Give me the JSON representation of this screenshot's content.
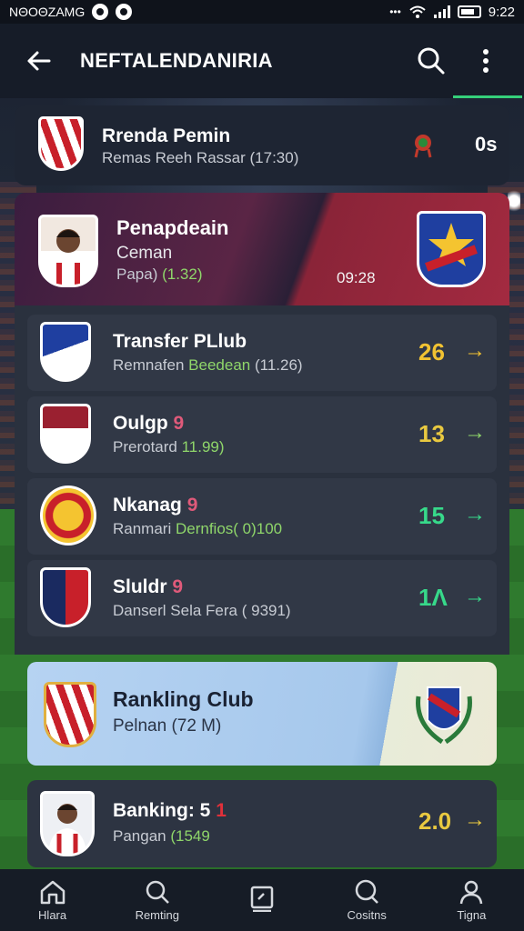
{
  "status_bar": {
    "left_text": "ΝΘΟΘΖΑΜG",
    "time": "9:22"
  },
  "app_bar": {
    "title": "NEFTALENDANIRIA"
  },
  "header_card": {
    "name": "Rrenda Pemin",
    "subtitle": "Remas Reeh Rassar (17:30)",
    "value": "0s"
  },
  "featured": {
    "name": "Penapdeain",
    "line2": "Ceman",
    "line3_prefix": "Papa) ",
    "line3_highlight": "(1.32)",
    "time": "09:28"
  },
  "rows": [
    {
      "name": "Transfer PLlub",
      "sub_prefix": "Remnafen ",
      "sub_highlight": "Beedean",
      "sub_suffix": " (11.26)",
      "score": "26",
      "score_color": "#f1c232"
    },
    {
      "name": "Oulgp",
      "badge": "9",
      "sub_prefix": "Prerotard ",
      "sub_highlight": "11.99)",
      "sub_suffix": "",
      "score": "13",
      "score_color": "#e9c940"
    },
    {
      "name": "Nkanag",
      "badge": "9",
      "sub_prefix": "Ranmari ",
      "sub_highlight": "Dernfios( 0)100",
      "sub_suffix": "",
      "score": "15",
      "score_color": "#37d98a"
    },
    {
      "name": "Sluldr",
      "badge": "9",
      "sub_prefix": "Danserl Sela Fera ( 9391)",
      "sub_highlight": "",
      "sub_suffix": "",
      "score": "1Λ",
      "score_color": "#37d98a"
    }
  ],
  "ranking_card": {
    "name": "Rankling Club",
    "subtitle": "Pelnan (72 M)"
  },
  "last_card": {
    "name": "Banking: 5",
    "badge": "1",
    "sub_prefix": "Pangan ",
    "sub_highlight": "(1549",
    "score": "2.0"
  },
  "bottom_nav": [
    {
      "label": "Hlara",
      "icon": "home-icon"
    },
    {
      "label": "Remting",
      "icon": "search-icon"
    },
    {
      "label": "",
      "icon": "clipboard-icon"
    },
    {
      "label": "Cositns",
      "icon": "search-icon"
    },
    {
      "label": "Tigna",
      "icon": "profile-icon"
    }
  ],
  "colors": {
    "accent": "#35d07a",
    "highlight_text": "#8fd66a",
    "badge": "#e05a7a"
  }
}
